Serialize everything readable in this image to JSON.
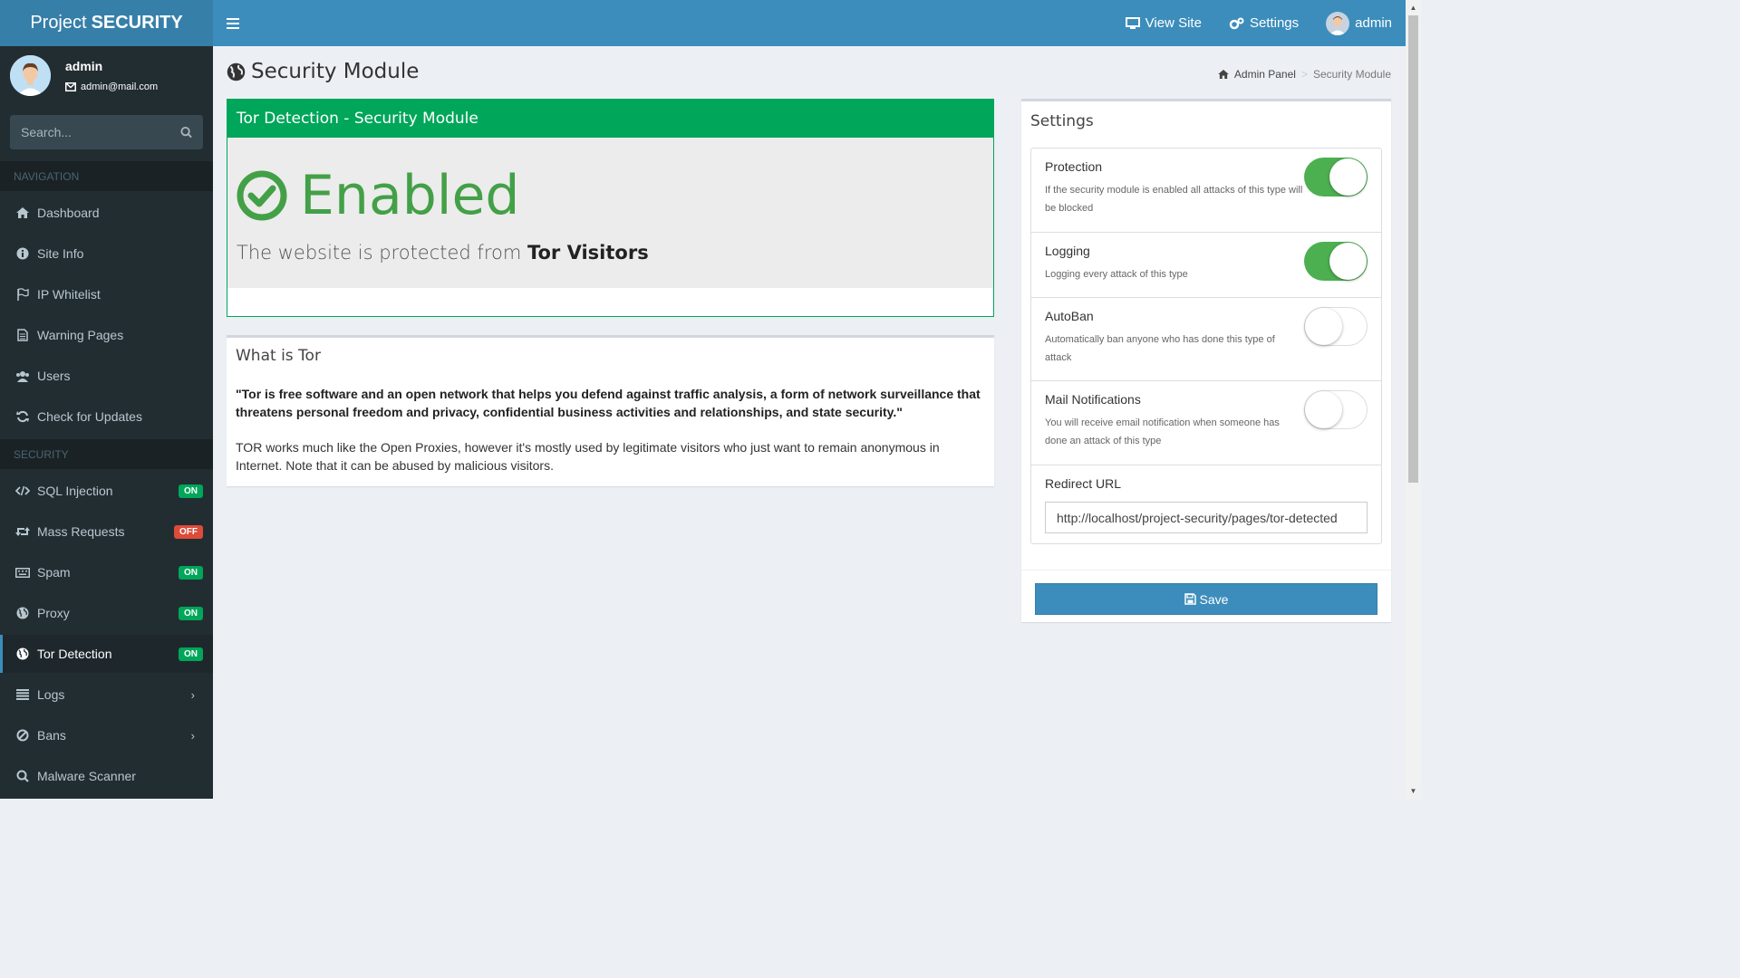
{
  "brand": {
    "light": "Project",
    "bold": "SECURITY"
  },
  "topbar": {
    "view_site": "View Site",
    "settings": "Settings",
    "user": "admin"
  },
  "user": {
    "name": "admin",
    "email": "admin@mail.com"
  },
  "search": {
    "placeholder": "Search..."
  },
  "nav": {
    "header_navigation": "NAVIGATION",
    "header_security": "SECURITY",
    "items": [
      {
        "label": "Dashboard",
        "icon": "home-icon"
      },
      {
        "label": "Site Info",
        "icon": "info-circle-icon"
      },
      {
        "label": "IP Whitelist",
        "icon": "flag-icon"
      },
      {
        "label": "Warning Pages",
        "icon": "file-text-icon"
      },
      {
        "label": "Users",
        "icon": "users-icon"
      },
      {
        "label": "Check for Updates",
        "icon": "refresh-icon"
      }
    ],
    "security_items": [
      {
        "label": "SQL Injection",
        "badge": "ON"
      },
      {
        "label": "Mass Requests",
        "badge": "OFF"
      },
      {
        "label": "Spam",
        "badge": "ON"
      },
      {
        "label": "Proxy",
        "badge": "ON"
      },
      {
        "label": "Tor Detection",
        "badge": "ON"
      },
      {
        "label": "Logs"
      },
      {
        "label": "Bans"
      },
      {
        "label": "Malware Scanner"
      }
    ]
  },
  "page": {
    "title": "Security Module"
  },
  "breadcrumb": {
    "home": "Admin Panel",
    "current": "Security Module"
  },
  "tor_box": {
    "header": "Tor Detection - Security Module",
    "status": "Enabled",
    "protected_prefix": "The website is protected from ",
    "protected_target": "Tor Visitors"
  },
  "what_box": {
    "title": "What is Tor",
    "quote": "\"Tor is free software and an open network that helps you defend against traffic analysis, a form of network surveillance that threatens personal freedom and privacy, confidential business activities and relationships, and state security.\"",
    "description": "TOR works much like the Open Proxies, however it's mostly used by legitimate visitors who just want to remain anonymous in Internet. Note that it can be abused by malicious visitors."
  },
  "settings": {
    "title": "Settings",
    "protection": {
      "label": "Protection",
      "hint": "If the security module is enabled all attacks of this type will be blocked",
      "enabled": true
    },
    "logging": {
      "label": "Logging",
      "hint": "Logging every attack of this type",
      "enabled": true
    },
    "autoban": {
      "label": "AutoBan",
      "hint": "Automatically ban anyone who has done this type of attack",
      "enabled": false
    },
    "mail": {
      "label": "Mail Notifications",
      "hint": "You will receive email notification when someone has done an attack of this type",
      "enabled": false
    },
    "redirect": {
      "label": "Redirect URL",
      "value": "http://localhost/project-security/pages/tor-detected"
    },
    "save_label": "Save"
  },
  "colors": {
    "accent": "#3c8dbc",
    "success": "#00a65a",
    "danger": "#dd4b39",
    "sidebar": "#222d32"
  }
}
